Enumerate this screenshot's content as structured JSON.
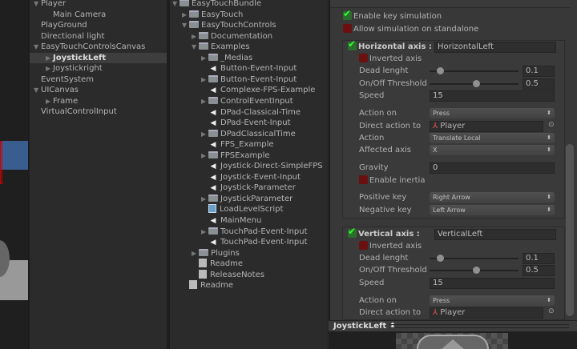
{
  "hierarchy": [
    {
      "label": "Player",
      "expanded": true,
      "depth": 0
    },
    {
      "label": "Main Camera",
      "depth": 1
    },
    {
      "label": "PlayGround",
      "depth": 0
    },
    {
      "label": "Directional light",
      "depth": 0
    },
    {
      "label": "EasyTouchControlsCanvas",
      "expanded": true,
      "depth": 0
    },
    {
      "label": "JoystickLeft",
      "collapsed": true,
      "depth": 1,
      "selected": true
    },
    {
      "label": "Joystickright",
      "collapsed": true,
      "depth": 1
    },
    {
      "label": "EventSystem",
      "depth": 0
    },
    {
      "label": "UICanvas",
      "expanded": true,
      "depth": 0
    },
    {
      "label": "Frame",
      "collapsed": true,
      "depth": 1
    },
    {
      "label": "VirtualControlInput",
      "depth": 0
    }
  ],
  "project": [
    {
      "label": "EasyTouchBundle",
      "icon": "folder",
      "arrow": "open",
      "depth": 0
    },
    {
      "label": "EasyTouch",
      "icon": "folder",
      "arrow": "closed",
      "depth": 1
    },
    {
      "label": "EasyTouchControls",
      "icon": "folder",
      "arrow": "open",
      "depth": 1
    },
    {
      "label": "Documentation",
      "icon": "folder",
      "arrow": "closed",
      "depth": 2
    },
    {
      "label": "Examples",
      "icon": "folder",
      "arrow": "open",
      "depth": 2
    },
    {
      "label": "_Medias",
      "icon": "folder",
      "arrow": "closed",
      "depth": 3
    },
    {
      "label": "Button-Event-Input",
      "icon": "unity",
      "depth": 3
    },
    {
      "label": "Button-Event-Input",
      "icon": "folder",
      "arrow": "closed",
      "depth": 3
    },
    {
      "label": "Complexe-FPS-Example",
      "icon": "unity",
      "depth": 3
    },
    {
      "label": "ControlEventInput",
      "icon": "folder",
      "arrow": "closed",
      "depth": 3
    },
    {
      "label": "DPad-Classical-Time",
      "icon": "unity",
      "depth": 3
    },
    {
      "label": "DPad-Event-Input",
      "icon": "unity",
      "depth": 3
    },
    {
      "label": "DPadClassicalTime",
      "icon": "folder",
      "arrow": "closed",
      "depth": 3
    },
    {
      "label": "FPS_Example",
      "icon": "unity",
      "depth": 3
    },
    {
      "label": "FPSExample",
      "icon": "folder",
      "arrow": "closed",
      "depth": 3
    },
    {
      "label": "Joystick-Direct-SimpleFPS",
      "icon": "unity",
      "depth": 3
    },
    {
      "label": "Joystick-Event-Input",
      "icon": "unity",
      "depth": 3
    },
    {
      "label": "Joystick-Parameter",
      "icon": "unity",
      "depth": 3
    },
    {
      "label": "JoystickParameter",
      "icon": "folder",
      "arrow": "closed",
      "depth": 3
    },
    {
      "label": "LoadLevelScript",
      "icon": "script",
      "depth": 3
    },
    {
      "label": "MainMenu",
      "icon": "unity",
      "depth": 3
    },
    {
      "label": "TouchPad-Event-Input",
      "icon": "folder",
      "arrow": "closed",
      "depth": 3
    },
    {
      "label": "TouchPad-Event-Input",
      "icon": "unity",
      "depth": 3
    },
    {
      "label": "Plugins",
      "icon": "folder",
      "arrow": "closed",
      "depth": 2
    },
    {
      "label": "Readme",
      "icon": "text",
      "depth": 2
    },
    {
      "label": "ReleaseNotes",
      "icon": "text",
      "depth": 2
    },
    {
      "label": "Readme",
      "icon": "text",
      "depth": 1
    }
  ],
  "inspector": {
    "enable_key_simulation": {
      "label": "Enable key simulation",
      "checked": true
    },
    "allow_standalone": {
      "label": "Allow simulation on standalone",
      "checked": false
    },
    "sections": [
      {
        "title": "Horizontal axis :",
        "enabled": true,
        "axis_name": "HorizontalLeft",
        "rows": [
          {
            "type": "check",
            "label": "Inverted axis",
            "checked": false
          },
          {
            "type": "slider",
            "label": "Dead lenght",
            "value": "0.1",
            "fraction": 0.1
          },
          {
            "type": "slider",
            "label": "On/Off Threshold",
            "value": "0.5",
            "fraction": 0.5
          },
          {
            "type": "text",
            "label": "Speed",
            "value": "15"
          },
          {
            "type": "dropdown",
            "label": "Action on",
            "value": "Press"
          },
          {
            "type": "object",
            "label": "Direct action to",
            "value": "Player"
          },
          {
            "type": "dropdown",
            "label": "Action",
            "value": "Translate Local"
          },
          {
            "type": "dropdown",
            "label": "Affected axis",
            "value": "X"
          },
          {
            "type": "text",
            "label": "Gravity",
            "value": "0"
          },
          {
            "type": "check",
            "label": "Enable inertia",
            "checked": false
          },
          {
            "type": "dropdown",
            "label": "Positive key",
            "value": "Right Arrow"
          },
          {
            "type": "dropdown",
            "label": "Negative key",
            "value": "Left Arrow"
          }
        ]
      },
      {
        "title": "Vertical axis :",
        "enabled": true,
        "axis_name": "VerticalLeft",
        "rows": [
          {
            "type": "check",
            "label": "Inverted axis",
            "checked": false
          },
          {
            "type": "slider",
            "label": "Dead lenght",
            "value": "0.1",
            "fraction": 0.1
          },
          {
            "type": "slider",
            "label": "On/Off Threshold",
            "value": "0.5",
            "fraction": 0.5
          },
          {
            "type": "text",
            "label": "Speed",
            "value": "15"
          },
          {
            "type": "dropdown",
            "label": "Action on",
            "value": "Press"
          },
          {
            "type": "object",
            "label": "Direct action to",
            "value": "Player"
          }
        ]
      }
    ]
  },
  "preview_bar": {
    "object": "JoystickLeft ⬍"
  }
}
